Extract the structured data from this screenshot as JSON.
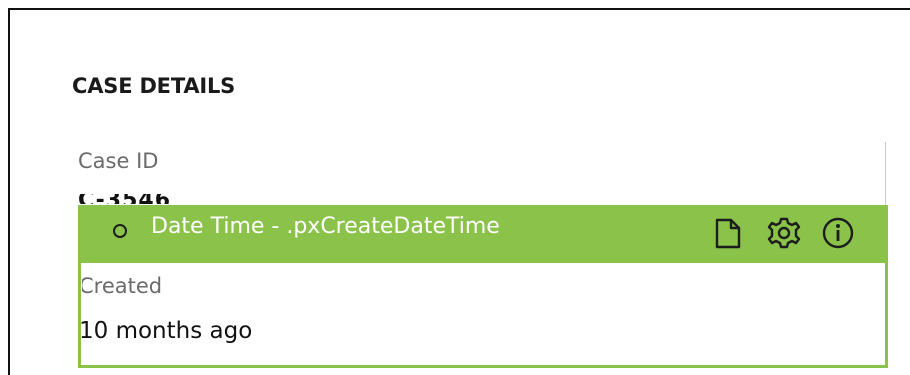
{
  "section": {
    "title": "CASE DETAILS"
  },
  "case_id": {
    "label": "Case ID",
    "value_partial": "C-3546"
  },
  "inspector": {
    "property_text": "Date Time - .pxCreateDateTime",
    "accent_color": "#8bc34a",
    "icons": [
      "copy-icon",
      "gear-icon",
      "info-icon"
    ]
  },
  "created": {
    "label": "Created",
    "value": "10 months ago"
  }
}
